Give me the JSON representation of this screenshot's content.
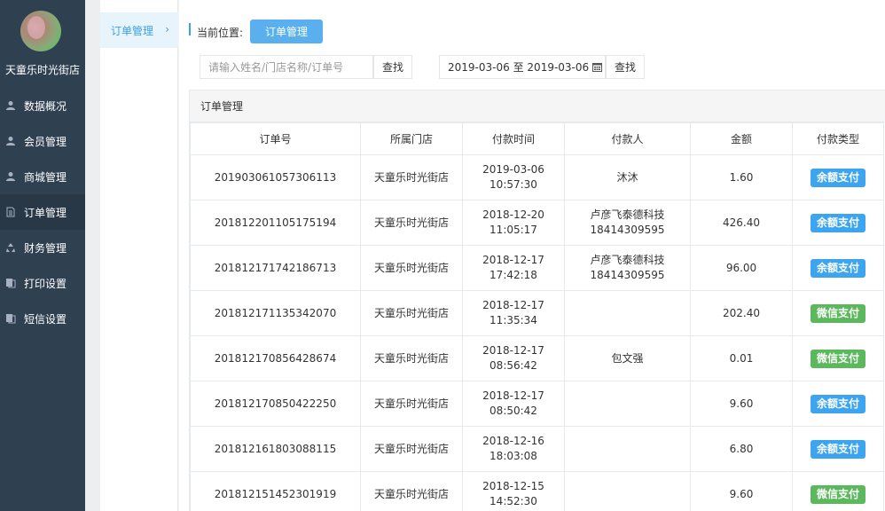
{
  "sidebar": {
    "shop_name": "天童乐时光街店",
    "items": [
      {
        "label": "数据概况",
        "icon": "user-icon",
        "active": false
      },
      {
        "label": "会员管理",
        "icon": "user-icon",
        "active": false
      },
      {
        "label": "商城管理",
        "icon": "user-icon",
        "active": false
      },
      {
        "label": "订单管理",
        "icon": "document-icon",
        "active": true
      },
      {
        "label": "财务管理",
        "icon": "recycle-icon",
        "active": false
      },
      {
        "label": "打印设置",
        "icon": "copy-icon",
        "active": false
      },
      {
        "label": "短信设置",
        "icon": "copy-icon",
        "active": false
      }
    ]
  },
  "subpanel": {
    "item_label": "订单管理",
    "chevron": "›"
  },
  "breadcrumb": {
    "label": "当前位置:",
    "current": "订单管理"
  },
  "search": {
    "placeholder": "请输入姓名/门店名称/订单号",
    "button": "查找"
  },
  "date_filter": {
    "start": "2019-03-06",
    "separator": "至",
    "end": "2019-03-06",
    "button": "查找"
  },
  "panel": {
    "title": "订单管理"
  },
  "table": {
    "headers": [
      "订单号",
      "所属门店",
      "付款时间",
      "付款人",
      "金额",
      "付款类型"
    ],
    "rows": [
      {
        "order_no": "201903061057306113",
        "store": "天童乐时光街店",
        "date": "2019-03-06",
        "time": "10:57:30",
        "payer1": "沐沐",
        "payer2": "",
        "amount": "1.60",
        "type": "余额支付",
        "type_color": "#3da5ef"
      },
      {
        "order_no": "201812201105175194",
        "store": "天童乐时光街店",
        "date": "2018-12-20",
        "time": "11:05:17",
        "payer1": "卢彦飞泰德科技",
        "payer2": "18414309595",
        "amount": "426.40",
        "type": "余额支付",
        "type_color": "#3da5ef"
      },
      {
        "order_no": "201812171742186713",
        "store": "天童乐时光街店",
        "date": "2018-12-17",
        "time": "17:42:18",
        "payer1": "卢彦飞泰德科技",
        "payer2": "18414309595",
        "amount": "96.00",
        "type": "余额支付",
        "type_color": "#3da5ef"
      },
      {
        "order_no": "201812171135342070",
        "store": "天童乐时光街店",
        "date": "2018-12-17",
        "time": "11:35:34",
        "payer1": "",
        "payer2": "",
        "amount": "202.40",
        "type": "微信支付",
        "type_color": "#5cb85c"
      },
      {
        "order_no": "201812170856428674",
        "store": "天童乐时光街店",
        "date": "2018-12-17",
        "time": "08:56:42",
        "payer1": "包文强",
        "payer2": "",
        "amount": "0.01",
        "type": "微信支付",
        "type_color": "#5cb85c"
      },
      {
        "order_no": "201812170850422250",
        "store": "天童乐时光街店",
        "date": "2018-12-17",
        "time": "08:50:42",
        "payer1": "",
        "payer2": "",
        "amount": "9.60",
        "type": "余额支付",
        "type_color": "#3da5ef"
      },
      {
        "order_no": "201812161803088115",
        "store": "天童乐时光街店",
        "date": "2018-12-16",
        "time": "18:03:08",
        "payer1": "",
        "payer2": "",
        "amount": "6.80",
        "type": "余额支付",
        "type_color": "#3da5ef"
      },
      {
        "order_no": "201812151452301919",
        "store": "天童乐时光街店",
        "date": "2018-12-15",
        "time": "14:52:30",
        "payer1": "",
        "payer2": "",
        "amount": "9.60",
        "type": "微信支付",
        "type_color": "#5cb85c"
      }
    ]
  }
}
